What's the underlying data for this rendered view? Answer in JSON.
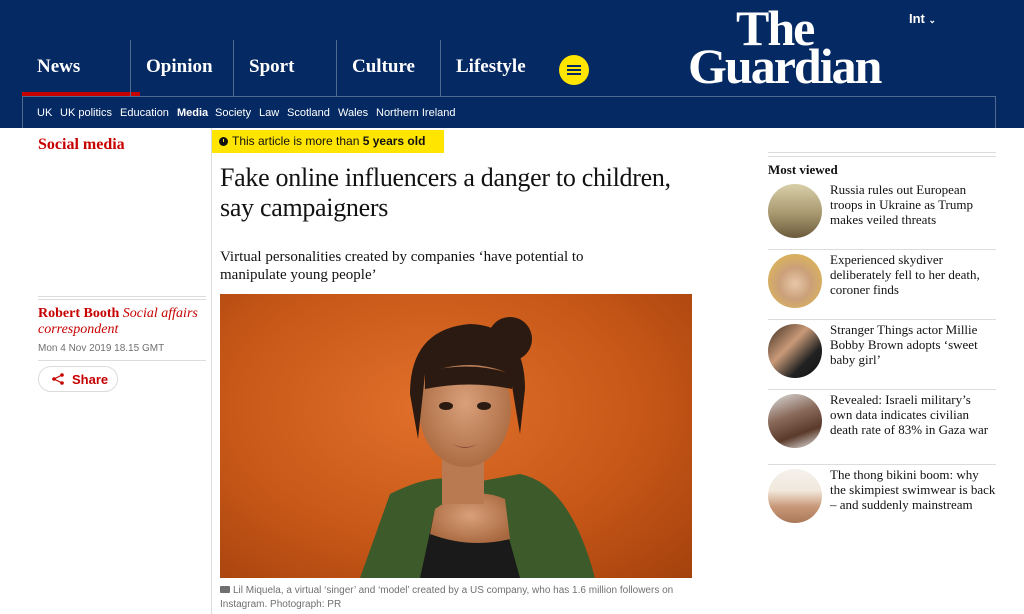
{
  "header": {
    "edition": "Int",
    "logo_line1": "The",
    "logo_line2": "Guardian",
    "pillars": [
      {
        "label": "News"
      },
      {
        "label": "Opinion"
      },
      {
        "label": "Sport"
      },
      {
        "label": "Culture"
      },
      {
        "label": "Lifestyle"
      }
    ],
    "active_pillar": "News",
    "subnav": [
      {
        "label": "UK"
      },
      {
        "label": "UK politics"
      },
      {
        "label": "Education"
      },
      {
        "label": "Media"
      },
      {
        "label": "Society"
      },
      {
        "label": "Law"
      },
      {
        "label": "Scotland"
      },
      {
        "label": "Wales"
      },
      {
        "label": "Northern Ireland"
      }
    ],
    "active_subnav": "Media"
  },
  "article": {
    "section": "Social media",
    "age_badge_prefix": "This article is more than ",
    "age_badge_value": "5 years old",
    "headline": "Fake online influencers a danger to children, say campaigners",
    "standfirst": "Virtual personalities created by companies ‘have potential to manipulate young people’",
    "author_name": "Robert Booth",
    "author_role": "Social affairs correspondent",
    "date": "Mon 4 Nov 2019 18.15 GMT",
    "share_label": "Share",
    "caption": "Lil Miquela, a virtual ‘singer’ and ‘model’ created by a US company, who has 1.6 million followers on Instagram. Photograph: PR"
  },
  "most_viewed": {
    "title": "Most viewed",
    "items": [
      {
        "headline": "Russia rules out European troops in Ukraine as Trump makes veiled threats"
      },
      {
        "headline": "Experienced skydiver deliberately fell to her death, coroner finds"
      },
      {
        "headline": "Stranger Things actor Millie Bobby Brown adopts ‘sweet baby girl’"
      },
      {
        "headline": "Revealed: Israeli military’s own data indicates civilian death rate of 83% in Gaza war"
      },
      {
        "headline": "The thong bikini boom: why the skimpiest swimwear is back – and suddenly mainstream"
      }
    ]
  },
  "colors": {
    "brand_blue": "#052962",
    "news_red": "#c70000",
    "highlight_yellow": "#ffe500"
  },
  "icons": {
    "menu": "hamburger-icon",
    "share": "share-icon",
    "clock": "clock-icon",
    "camera": "camera-icon",
    "edition_chevron": "chevron-down-icon"
  }
}
